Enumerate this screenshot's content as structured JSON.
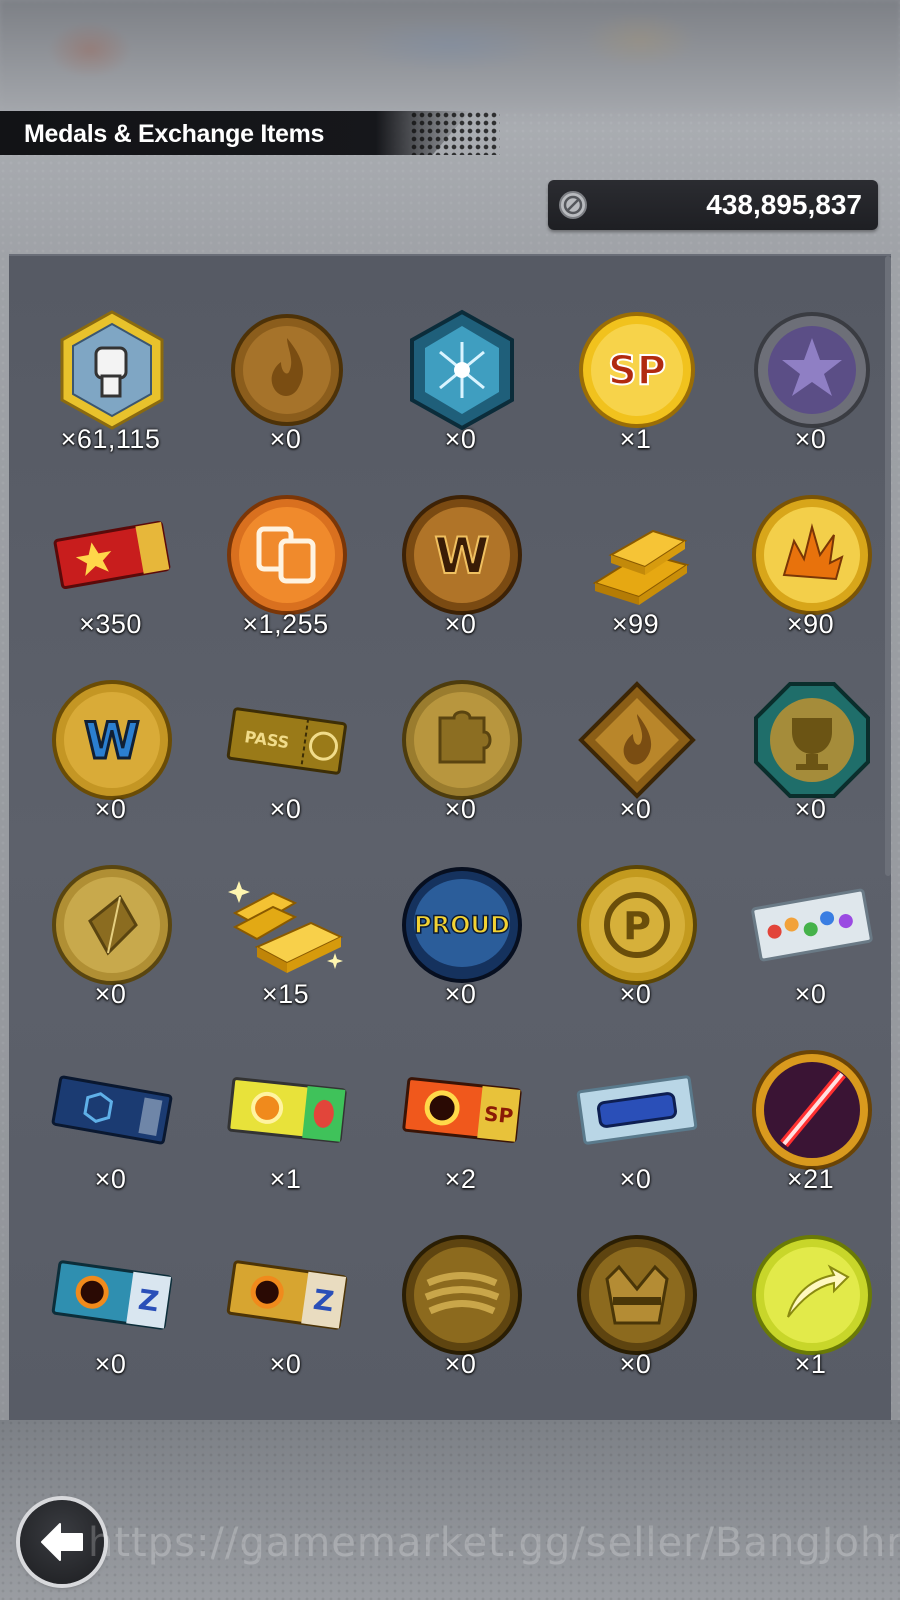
{
  "header": {
    "title": "Medals & Exchange Items"
  },
  "currency": {
    "icon": "silver-coin-icon",
    "amount": "438,895,837"
  },
  "items": [
    {
      "icon": "fist-hexagon-medal-icon",
      "count": "×61,115"
    },
    {
      "icon": "bronze-flame-coin-icon",
      "count": "×0"
    },
    {
      "icon": "blue-crystal-hexagon-icon",
      "count": "×0"
    },
    {
      "icon": "sp-gold-coin-icon",
      "count": "×1"
    },
    {
      "icon": "purple-emblem-coin-icon",
      "count": "×0"
    },
    {
      "icon": "red-star-ticket-icon",
      "count": "×350"
    },
    {
      "icon": "orange-card-coin-icon",
      "count": "×1,255"
    },
    {
      "icon": "w-bronze-coin-icon",
      "count": "×0"
    },
    {
      "icon": "gold-bars-icon",
      "count": "×99"
    },
    {
      "icon": "gold-burst-coin-icon",
      "count": "×90"
    },
    {
      "icon": "w-blue-gold-coin-icon",
      "count": "×0"
    },
    {
      "icon": "gold-pass-ticket-icon",
      "count": "×0"
    },
    {
      "icon": "puzzle-gold-coin-icon",
      "count": "×0"
    },
    {
      "icon": "flame-diamond-badge-icon",
      "count": "×0"
    },
    {
      "icon": "trophy-octagon-badge-icon",
      "count": "×0"
    },
    {
      "icon": "crystal-gold-coin-icon",
      "count": "×0"
    },
    {
      "icon": "sparkling-gold-bars-icon",
      "count": "×15"
    },
    {
      "icon": "proud-blue-coin-icon",
      "count": "×0"
    },
    {
      "icon": "p-gold-coin-icon",
      "count": "×0"
    },
    {
      "icon": "rainbow-gems-ticket-icon",
      "count": "×0"
    },
    {
      "icon": "blue-hexagon-ticket-icon",
      "count": "×0"
    },
    {
      "icon": "green-meteor-ticket-icon",
      "count": "×1"
    },
    {
      "icon": "sp-meteor-ticket-icon",
      "count": "×2"
    },
    {
      "icon": "blue-plate-ticket-icon",
      "count": "×0"
    },
    {
      "icon": "red-saber-coin-icon",
      "count": "×21"
    },
    {
      "icon": "blue-z-meteor-ticket-icon",
      "count": "×0"
    },
    {
      "icon": "gold-z-meteor-ticket-icon",
      "count": "×0"
    },
    {
      "icon": "bandage-bronze-coin-icon",
      "count": "×0"
    },
    {
      "icon": "gi-bronze-coin-icon",
      "count": "×0"
    },
    {
      "icon": "green-arrow-coin-icon",
      "count": "×1"
    }
  ],
  "nav": {
    "back_icon": "back-arrow-icon"
  },
  "watermark": {
    "text": "https://gamemarket.gg/seller/BangJohn"
  },
  "colors": {
    "panel": "#5b5f69",
    "header_bar": "#141519",
    "gold": "#e6b422"
  }
}
